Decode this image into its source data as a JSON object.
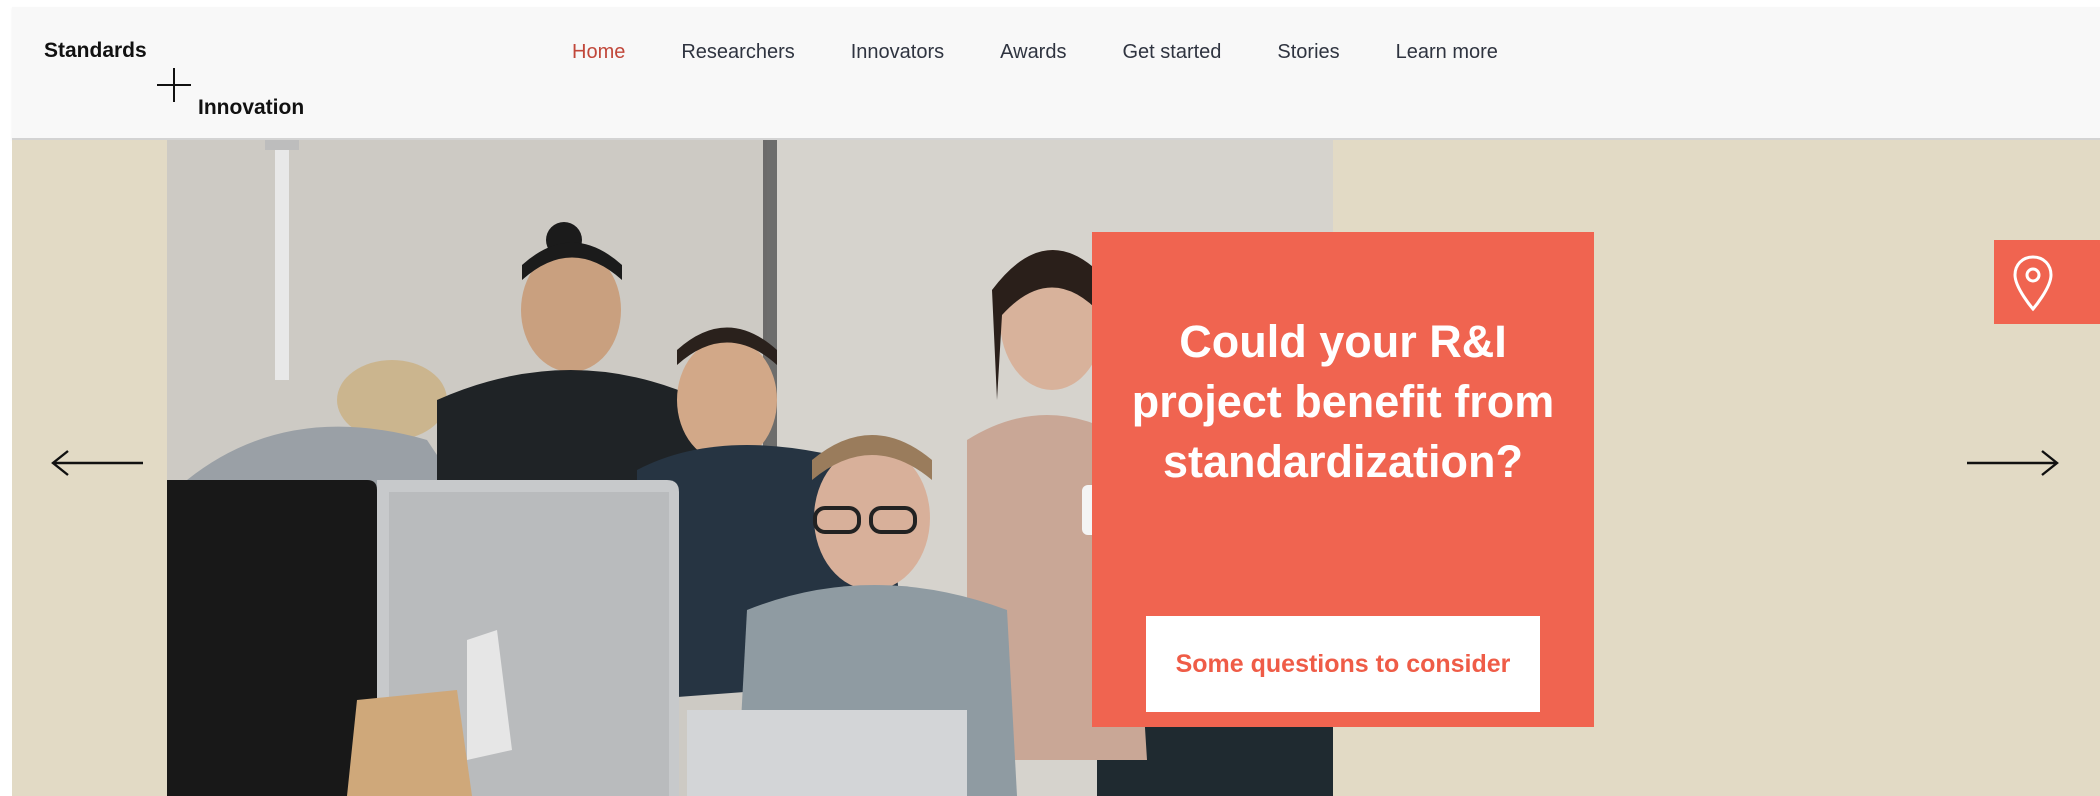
{
  "logo": {
    "word1": "Standards",
    "word2": "Innovation"
  },
  "nav": {
    "items": [
      {
        "label": "Home",
        "active": true
      },
      {
        "label": "Researchers"
      },
      {
        "label": "Innovators"
      },
      {
        "label": "Awards"
      },
      {
        "label": "Get started"
      },
      {
        "label": "Stories"
      },
      {
        "label": "Learn more"
      }
    ]
  },
  "hero": {
    "title": "Could your R&I project benefit from standardization?",
    "cta_label": "Some questions to consider"
  },
  "icons": {
    "prev": "arrow-left-icon",
    "next": "arrow-right-icon",
    "location": "map-pin-icon",
    "plus": "plus-icon"
  },
  "colors": {
    "accent": "#f06450",
    "hero_bg": "#e2dac5",
    "nav_active": "#c1473a",
    "header_bg": "#f8f8f8"
  }
}
